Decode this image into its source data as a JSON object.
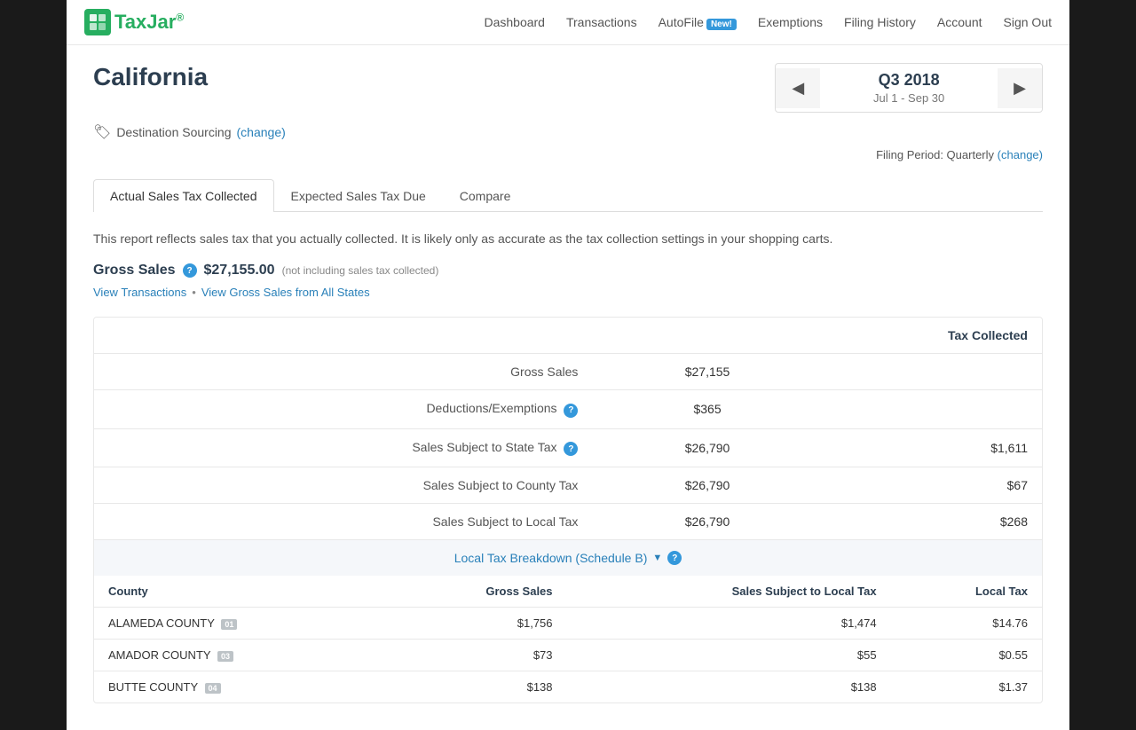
{
  "logo": {
    "icon_text": "TJ",
    "text_part1": "Tax",
    "text_part2": "Jar",
    "trademark": "®"
  },
  "nav": {
    "items": [
      {
        "label": "Dashboard",
        "href": "#"
      },
      {
        "label": "Transactions",
        "href": "#"
      },
      {
        "label": "AutoFile",
        "href": "#",
        "badge": "New!"
      },
      {
        "label": "Exemptions",
        "href": "#"
      },
      {
        "label": "Filing History",
        "href": "#"
      },
      {
        "label": "Account",
        "href": "#"
      },
      {
        "label": "Sign Out",
        "href": "#"
      }
    ]
  },
  "page": {
    "title": "California",
    "sourcing_label": "Destination Sourcing",
    "sourcing_change_link": "change",
    "filing_period_label": "Filing Period: Quarterly",
    "filing_period_change_link": "change"
  },
  "quarter_nav": {
    "quarter": "Q3 2018",
    "dates": "Jul 1 - Sep 30",
    "prev_label": "◀",
    "next_label": "▶"
  },
  "tabs": [
    {
      "label": "Actual Sales Tax Collected",
      "active": true
    },
    {
      "label": "Expected Sales Tax Due",
      "active": false
    },
    {
      "label": "Compare",
      "active": false
    }
  ],
  "report": {
    "description": "This report reflects sales tax that you actually collected. It is likely only as accurate as the tax collection settings in your shopping carts.",
    "gross_sales_label": "Gross Sales",
    "gross_sales_amount": "$27,155.00",
    "gross_sales_note": "(not including sales tax collected)",
    "view_transactions_link": "View Transactions",
    "view_gross_sales_link": "View Gross Sales from All States",
    "separator": "•"
  },
  "main_table": {
    "header_tax_collected": "Tax Collected",
    "rows": [
      {
        "label": "Gross Sales",
        "value": "$27,155",
        "tax": ""
      },
      {
        "label": "Deductions/Exemptions",
        "value": "$365",
        "tax": "",
        "has_info": true
      },
      {
        "label": "Sales Subject to State Tax",
        "value": "$26,790",
        "tax": "$1,611",
        "has_info": true
      },
      {
        "label": "Sales Subject to County Tax",
        "value": "$26,790",
        "tax": "$67"
      },
      {
        "label": "Sales Subject to Local Tax",
        "value": "$26,790",
        "tax": "$268"
      }
    ]
  },
  "local_breakdown": {
    "label": "Local Tax Breakdown (Schedule B)",
    "chevron": "▼",
    "info_icon": "?"
  },
  "county_table": {
    "headers": [
      "County",
      "Gross Sales",
      "Sales Subject to Local Tax",
      "Local Tax"
    ],
    "rows": [
      {
        "county": "ALAMEDA COUNTY",
        "badge": "01",
        "gross_sales": "$1,756",
        "sales_subject": "$1,474",
        "local_tax": "$14.76"
      },
      {
        "county": "AMADOR COUNTY",
        "badge": "03",
        "gross_sales": "$73",
        "sales_subject": "$55",
        "local_tax": "$0.55"
      },
      {
        "county": "BUTTE COUNTY",
        "badge": "04",
        "gross_sales": "$138",
        "sales_subject": "$138",
        "local_tax": "$1.37"
      }
    ]
  }
}
